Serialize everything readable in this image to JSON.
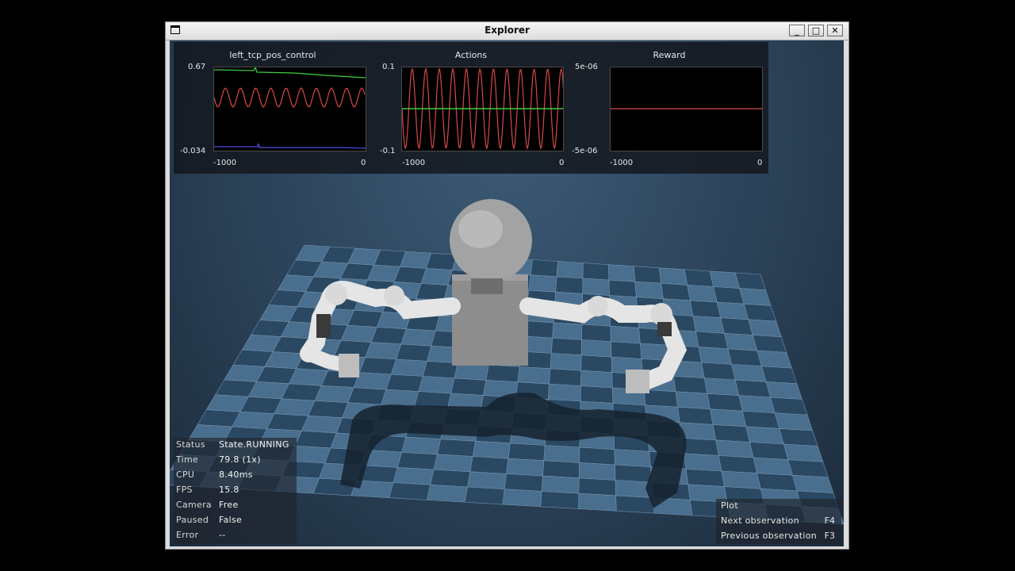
{
  "window": {
    "title": "Explorer",
    "minimize": "_",
    "maximize": "□",
    "close": "✕"
  },
  "plots": [
    {
      "title": "left_tcp_pos_control",
      "ymax": "0.67",
      "ymin": "-0.034",
      "xmin": "-1000",
      "xmax": "0",
      "series_colors": [
        "#3ccc3c",
        "#d84848",
        "#4d4de0"
      ]
    },
    {
      "title": "Actions",
      "ymax": "0.1",
      "ymin": "-0.1",
      "xmin": "-1000",
      "xmax": "0",
      "series_colors": [
        "#d84848",
        "#3ccc3c"
      ]
    },
    {
      "title": "Reward",
      "ymax": "5e-06",
      "ymin": "-5e-06",
      "xmin": "-1000",
      "xmax": "0",
      "series_colors": [
        "#d84848"
      ]
    }
  ],
  "status": [
    {
      "key": "Status",
      "value": "State.RUNNING"
    },
    {
      "key": "Time",
      "value": "79.8 (1x)"
    },
    {
      "key": "CPU",
      "value": "8.40ms"
    },
    {
      "key": "FPS",
      "value": "15.8"
    },
    {
      "key": "Camera",
      "value": "Free"
    },
    {
      "key": "Paused",
      "value": "False"
    },
    {
      "key": "Error",
      "value": "--"
    }
  ],
  "help": [
    {
      "key": "Plot",
      "value": ""
    },
    {
      "key": "Next observation",
      "value": "F4"
    },
    {
      "key": "Previous observation",
      "value": "F3"
    }
  ],
  "colors": {
    "floor_light": "#4a6f8e",
    "floor_dark": "#2a4862",
    "robot_white": "#e8e8e8",
    "robot_gray": "#8e8e8e"
  }
}
